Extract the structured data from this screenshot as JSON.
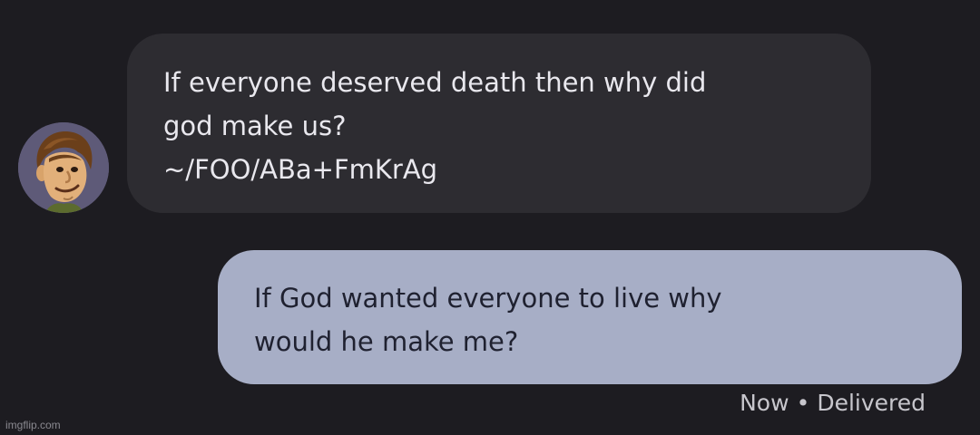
{
  "incoming_message": {
    "lines": [
      "If everyone deserved death then why did",
      "god make us?",
      "~/FOO/ABa+FmKrAg"
    ]
  },
  "outgoing_message": {
    "lines": [
      "If God wanted everyone to live why",
      "would he make me?"
    ]
  },
  "status": {
    "time": "Now",
    "separator": "•",
    "state": "Delivered"
  },
  "watermark": "imgflip.com",
  "colors": {
    "background": "#1d1c21",
    "incoming_bubble": "#2d2c31",
    "outgoing_bubble": "#a7aec6",
    "avatar_bg": "#5e5a78"
  }
}
